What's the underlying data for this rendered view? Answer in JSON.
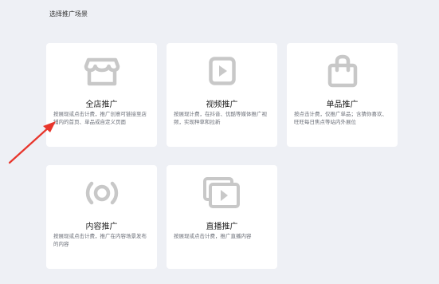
{
  "page": {
    "title": "选择推广场景"
  },
  "cards": [
    {
      "title": "全店推广",
      "desc": "按展现或点击计费，推广创意可链接至店铺内的首页、单品或自定义页面",
      "icon": "store-icon"
    },
    {
      "title": "视频推广",
      "desc": "按展现计费，在抖音、优酷等媒体推广视频，实现种草和拉新",
      "icon": "video-icon"
    },
    {
      "title": "单品推广",
      "desc": "按点击计费，仅推广单品；含猜你喜欢、旺旺每日焦点等站内外展位",
      "icon": "shopping-bag-icon"
    },
    {
      "title": "内容推广",
      "desc": "按展现或点击计费，推广在内容场景发布的内容",
      "icon": "content-ring-icon"
    },
    {
      "title": "直播推广",
      "desc": "按展现或点击计费，推广直播内容",
      "icon": "live-stream-icon"
    }
  ],
  "colors": {
    "background": "#eef0f5",
    "card": "#ffffff",
    "icon": "#c8c8c8",
    "annotation_arrow": "#e8352b"
  }
}
